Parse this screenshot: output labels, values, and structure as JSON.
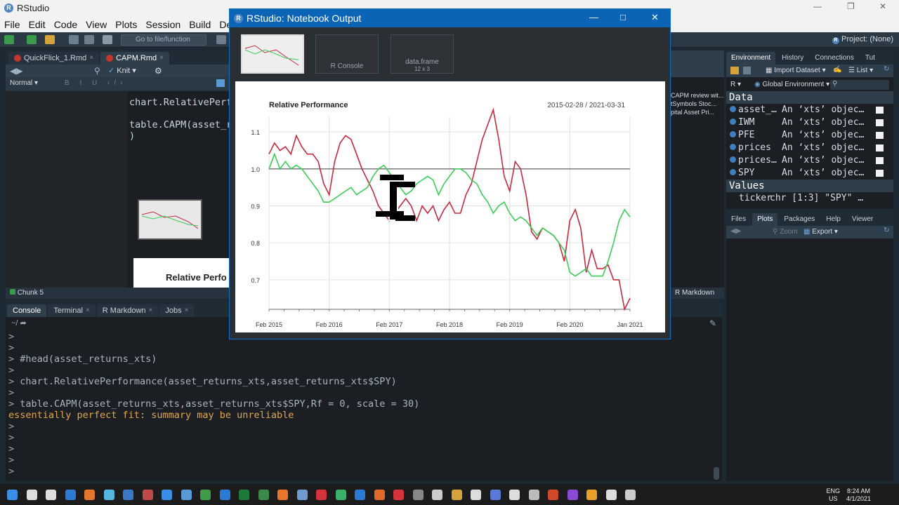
{
  "app": {
    "title": "RStudio",
    "project": "Project: (None)"
  },
  "menu": [
    "File",
    "Edit",
    "Code",
    "View",
    "Plots",
    "Session",
    "Build",
    "Debu"
  ],
  "toolbar": {
    "goto_placeholder": "Go to file/function"
  },
  "source": {
    "tabs": [
      {
        "label": "QuickFlick_1.Rmd",
        "active": false
      },
      {
        "label": "CAPM.Rmd",
        "active": true
      }
    ],
    "knit_label": "Knit",
    "format_label": "Normal",
    "code_lines": [
      "chart.RelativePerf",
      "table.CAPM(asset_r",
      ")"
    ],
    "preview_title": "Relative Perfo",
    "chunk_label": "Chunk 5",
    "doc_type": "R Markdown",
    "outline_items": [
      "CAPM review wit...",
      "tSymbols Stoc...",
      "pital Asset Pri..."
    ]
  },
  "console": {
    "tabs": [
      {
        "label": "Console",
        "active": true
      },
      {
        "label": "Terminal",
        "active": false
      },
      {
        "label": "R Markdown",
        "active": false
      },
      {
        "label": "Jobs",
        "active": false
      }
    ],
    "path": "~/",
    "lines": [
      {
        "prompt": ">",
        "text": ""
      },
      {
        "prompt": ">",
        "text": ""
      },
      {
        "prompt": ">",
        "text": "#head(asset_returns_xts)"
      },
      {
        "prompt": ">",
        "text": ""
      },
      {
        "prompt": ">",
        "text": "chart.RelativePerformance(asset_returns_xts,asset_returns_xts$SPY)"
      },
      {
        "prompt": ">",
        "text": ""
      },
      {
        "prompt": ">",
        "text": "table.CAPM(asset_returns_xts,asset_returns_xts$SPY,Rf = 0, scale = 30)"
      },
      {
        "prompt": "",
        "text": "essentially perfect fit: summary may be unreliable",
        "warn": true
      },
      {
        "prompt": ">",
        "text": ""
      },
      {
        "prompt": ">",
        "text": ""
      },
      {
        "prompt": ">",
        "text": ""
      },
      {
        "prompt": ">",
        "text": ""
      },
      {
        "prompt": ">",
        "text": ""
      }
    ]
  },
  "environment": {
    "tabs": [
      "Environment",
      "History",
      "Connections",
      "Tut"
    ],
    "import_label": "Import Dataset",
    "list_label": "List",
    "lang": "R",
    "scope": "Global Environment",
    "data_header": "Data",
    "values_header": "Values",
    "data_rows": [
      {
        "name": "asset_…",
        "desc": "An ‘xts’ objec…"
      },
      {
        "name": "IWM",
        "desc": "An ‘xts’ objec…"
      },
      {
        "name": "PFE",
        "desc": "An ‘xts’ objec…"
      },
      {
        "name": "prices",
        "desc": "An ‘xts’ objec…"
      },
      {
        "name": "prices…",
        "desc": "An ‘xts’ objec…"
      },
      {
        "name": "SPY",
        "desc": "An ‘xts’ objec…"
      }
    ],
    "value_rows": [
      {
        "name": "ticker",
        "desc": "chr [1:3] \"SPY\" …"
      }
    ]
  },
  "files": {
    "tabs": [
      "Files",
      "Plots",
      "Packages",
      "Help",
      "Viewer"
    ],
    "zoom_label": "Zoom",
    "export_label": "Export"
  },
  "popup": {
    "title": "RStudio: Notebook Output",
    "thumbs": [
      {
        "label": "",
        "sub": ""
      },
      {
        "label": "R Console",
        "sub": ""
      },
      {
        "label": "data.frame",
        "sub": "12 x 3"
      }
    ]
  },
  "chart_data": {
    "type": "line",
    "title": "Relative Performance",
    "subtitle": "2015-02-28 / 2021-03-31",
    "x_tick_labels": [
      "Feb 2015",
      "Feb 2016",
      "Feb 2017",
      "Feb 2018",
      "Feb 2019",
      "Feb 2020",
      "Jan 2021"
    ],
    "y_tick_labels": [
      "0.7",
      "0.8",
      "0.9",
      "1.0",
      "1.1"
    ],
    "ylim": [
      0.62,
      1.18
    ],
    "baseline": 1.0,
    "grid": true,
    "series": [
      {
        "color": "#c8283c",
        "values": [
          1.04,
          1.07,
          1.05,
          1.06,
          1.04,
          1.09,
          1.06,
          1.04,
          1.04,
          1.02,
          0.96,
          0.93,
          1.02,
          1.07,
          1.09,
          1.08,
          1.04,
          1.0,
          0.97,
          0.94,
          0.9,
          0.88,
          0.86,
          0.88,
          0.9,
          0.92,
          0.9,
          0.86,
          0.9,
          0.88,
          0.9,
          0.86,
          0.89,
          0.91,
          0.88,
          0.88,
          0.93,
          0.96,
          1.02,
          1.08,
          1.12,
          1.16,
          1.08,
          0.98,
          0.94,
          1.02,
          1.0,
          0.93,
          0.83,
          0.81,
          0.84,
          0.83,
          0.82,
          0.8,
          0.75,
          0.86,
          0.89,
          0.84,
          0.72,
          0.78,
          0.73,
          0.73,
          0.74,
          0.7,
          0.7,
          0.62,
          0.65
        ]
      },
      {
        "color": "#3ccd5a",
        "values": [
          1.0,
          1.04,
          1.0,
          1.02,
          1.0,
          1.01,
          1.0,
          0.98,
          0.96,
          0.94,
          0.91,
          0.91,
          0.92,
          0.93,
          0.94,
          0.95,
          0.93,
          0.94,
          0.95,
          0.98,
          1.0,
          1.01,
          0.99,
          0.97,
          0.95,
          0.93,
          0.94,
          0.96,
          0.97,
          0.98,
          0.97,
          0.93,
          0.96,
          0.98,
          1.0,
          1.0,
          0.99,
          0.97,
          0.96,
          0.93,
          0.91,
          0.88,
          0.9,
          0.91,
          0.88,
          0.86,
          0.87,
          0.86,
          0.84,
          0.82,
          0.84,
          0.83,
          0.82,
          0.8,
          0.78,
          0.72,
          0.71,
          0.72,
          0.73,
          0.71,
          0.71,
          0.71,
          0.75,
          0.8,
          0.86,
          0.89,
          0.87
        ]
      }
    ]
  }
}
